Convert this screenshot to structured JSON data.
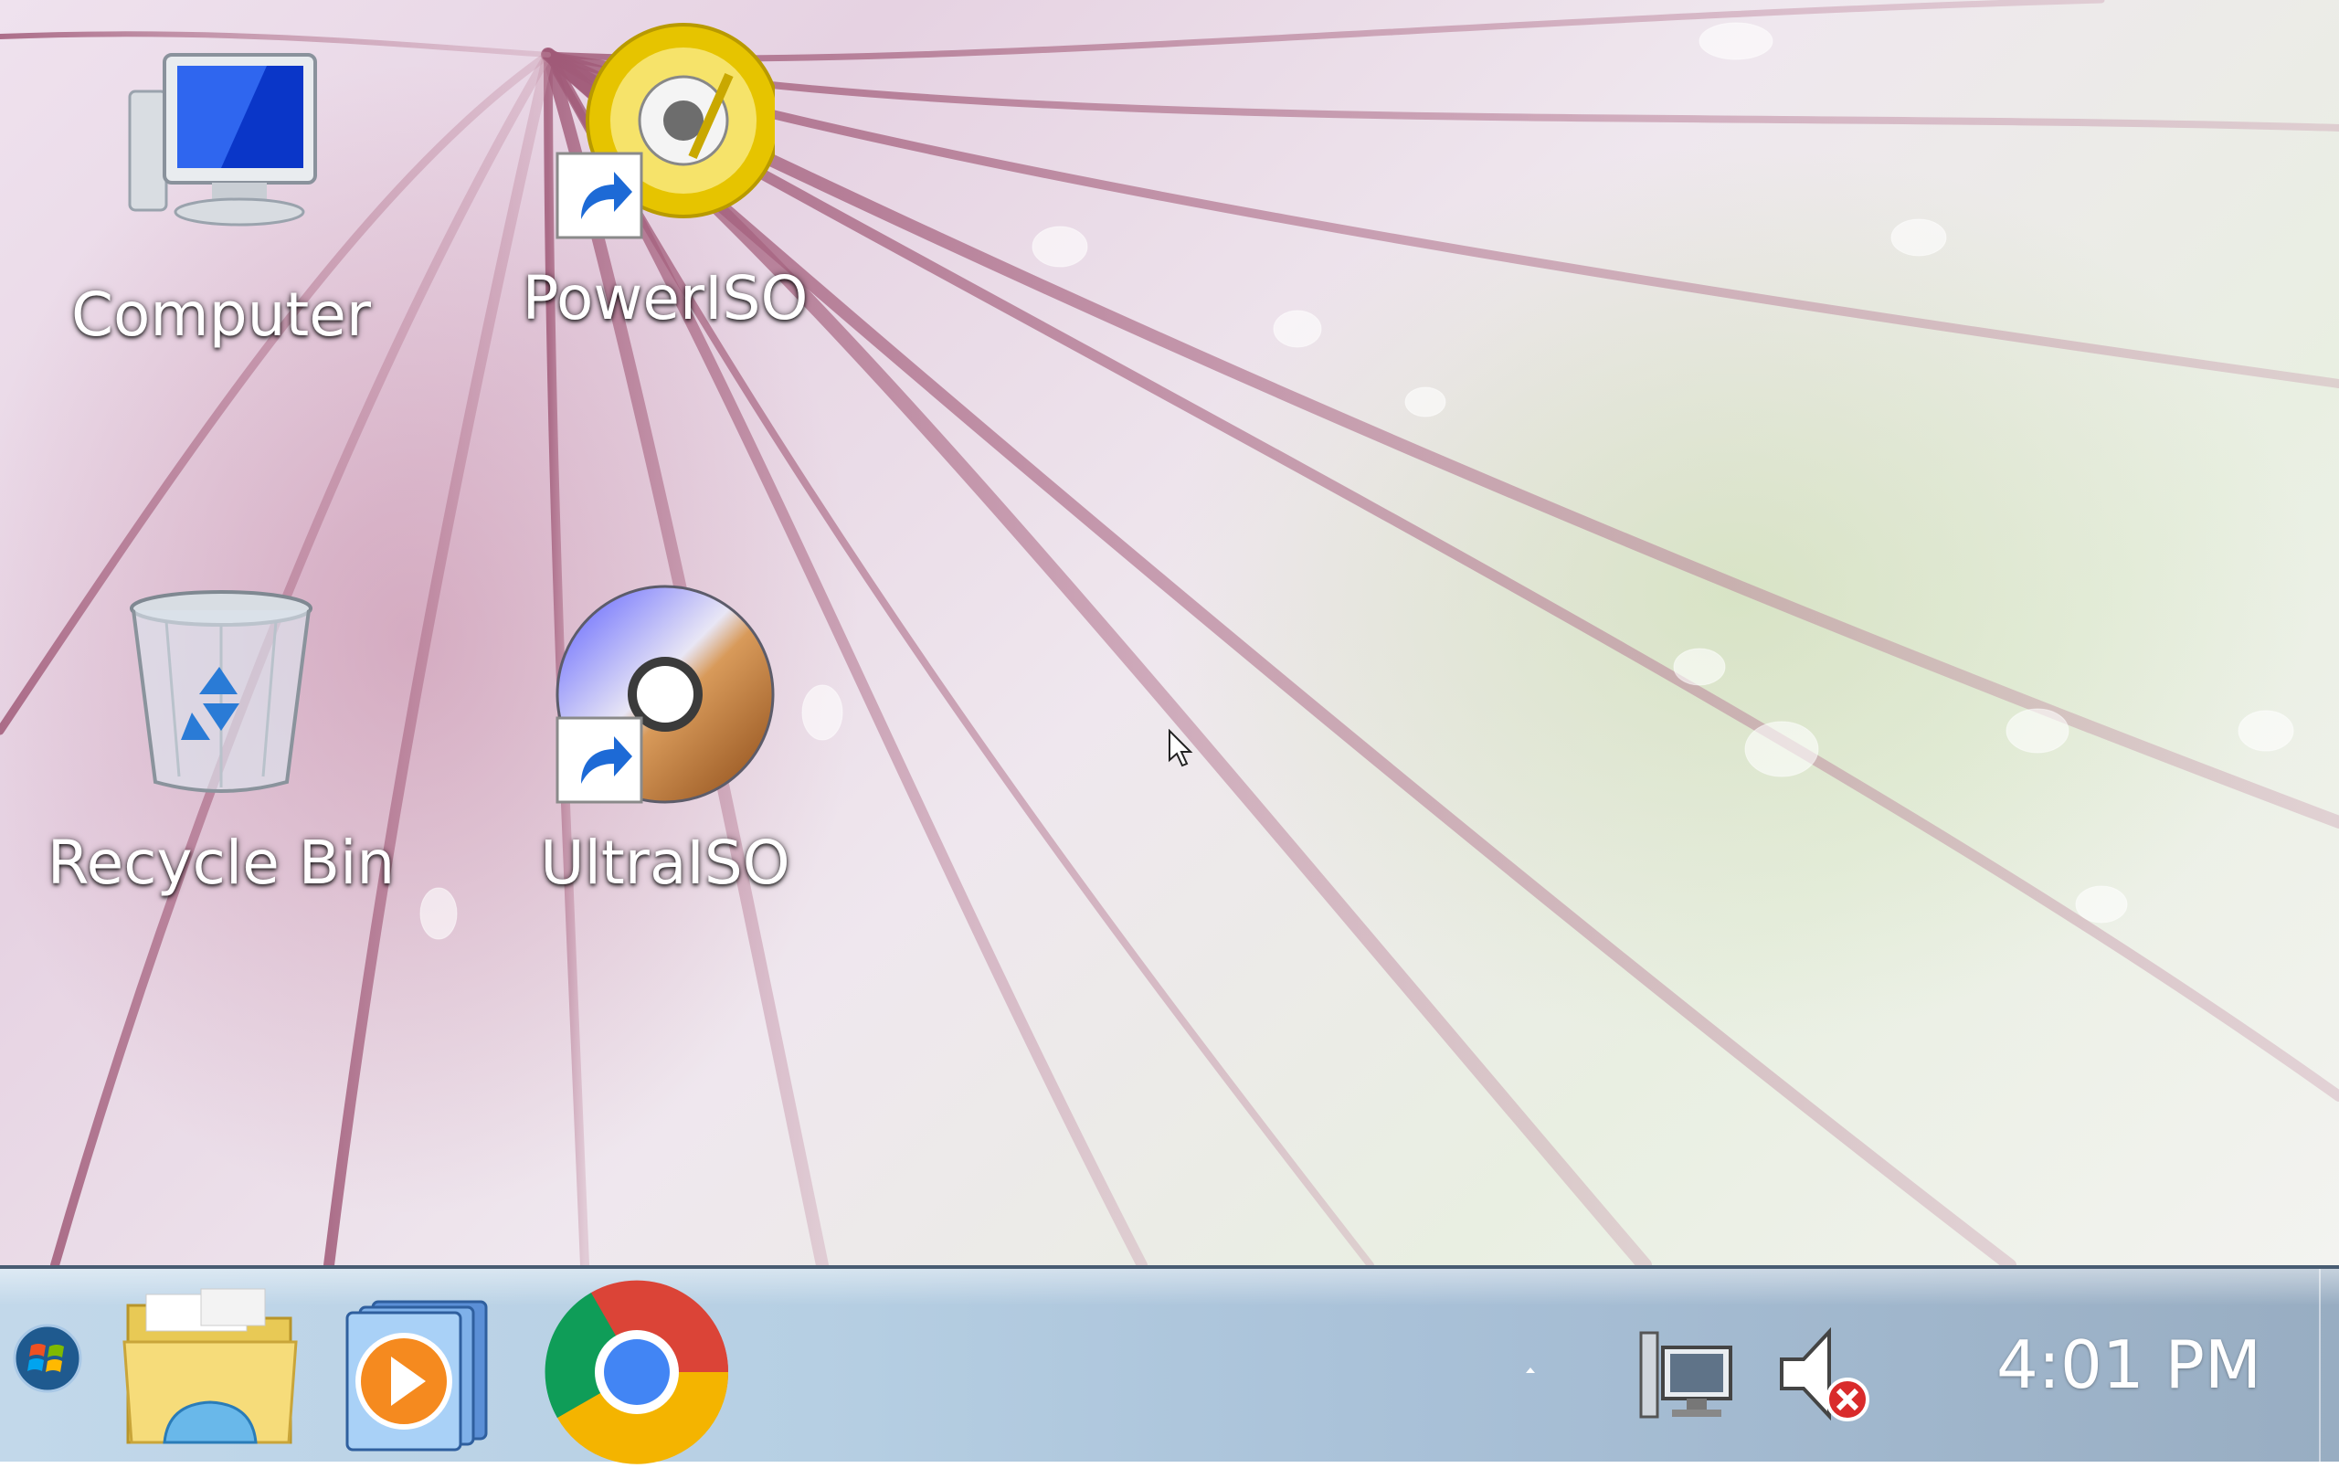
{
  "desktop": {
    "icons": [
      {
        "label": "Computer"
      },
      {
        "label": "PowerISO"
      },
      {
        "label": "Recycle Bin"
      },
      {
        "label": "UltraISO"
      }
    ]
  },
  "taskbar": {
    "start_icon": "windows-logo-icon",
    "pinned": [
      "windows-explorer-icon",
      "windows-media-player-icon",
      "chrome-icon"
    ],
    "tray": {
      "icons": [
        "show-hidden-icons-arrow",
        "network-icon",
        "volume-muted-icon"
      ],
      "clock": "4:01 PM"
    }
  },
  "colors": {
    "taskbar": "#b6cfe3",
    "label_text": "#ffffff"
  }
}
